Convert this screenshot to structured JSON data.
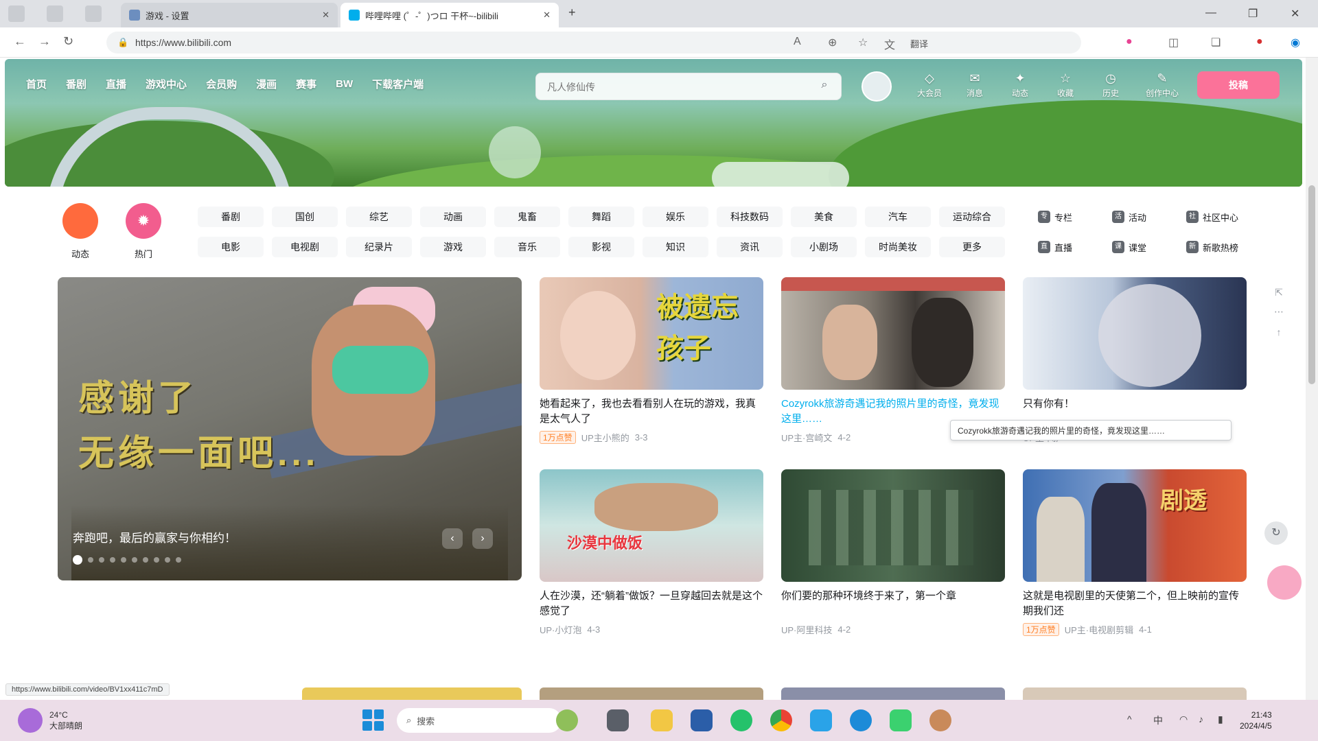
{
  "browser": {
    "tabs": [
      {
        "title": "游戏 - 设置",
        "active": false
      },
      {
        "title": "哔哩哔哩 (゜-゜)つロ 干杯~-bilibili",
        "active": true
      }
    ],
    "new_tab": "+",
    "url": "https://www.bilibili.com",
    "translate_label": "翻译"
  },
  "site": {
    "top_nav": [
      "首页",
      "番剧",
      "直播",
      "游戏中心",
      "会员购",
      "漫画",
      "赛事",
      "BW",
      "下载客户端"
    ],
    "search_placeholder": "凡人修仙传",
    "top_icons": [
      {
        "icon": "大会员",
        "label": "大会员"
      },
      {
        "icon": "消息",
        "label": "消息"
      },
      {
        "icon": "动态",
        "label": "动态"
      },
      {
        "icon": "收藏",
        "label": "收藏"
      },
      {
        "icon": "历史",
        "label": "历史"
      },
      {
        "icon": "创作中心",
        "label": "创作中心"
      }
    ],
    "upload_label": "投稿",
    "dynamic_label": "动态",
    "hot_label": "热门",
    "channels": [
      "番剧",
      "国创",
      "综艺",
      "动画",
      "鬼畜",
      "舞蹈",
      "娱乐",
      "科技数码",
      "美食",
      "汽车",
      "运动综合",
      "电影",
      "电视剧",
      "纪录片",
      "游戏",
      "音乐",
      "影视",
      "知识",
      "资讯",
      "小剧场",
      "时尚美妆",
      "更多"
    ],
    "side_links": [
      {
        "icon": "专",
        "label": "专栏"
      },
      {
        "icon": "活",
        "label": "活动"
      },
      {
        "icon": "社",
        "label": "社区中心"
      },
      {
        "icon": "直",
        "label": "直播"
      },
      {
        "icon": "课",
        "label": "课堂"
      },
      {
        "icon": "新",
        "label": "新歌热榜"
      }
    ],
    "carousel": {
      "overlay_line1": "感谢了",
      "overlay_line2": "无缘一面吧...",
      "title": "奔跑吧，最后的赢家与你相约！",
      "slides": 10
    },
    "videos": [
      {
        "title": "她看起来了，我也去看看别人在玩的游戏，我真是太气人了",
        "badge": "1万点赞",
        "author": "UP主小熊的",
        "date": "3-3",
        "overlay": "被遗忘 孩子",
        "blue": false
      },
      {
        "title": "Cozyrokk旅游奇遇记我的照片里的奇怪，竟发现这里……",
        "badge": "",
        "author": "UP主·宫崎文",
        "date": "4-2",
        "overlay": "",
        "blue": true
      },
      {
        "title": "只有你有！",
        "badge": "",
        "author": "UP主·闻声",
        "date": "4-1",
        "overlay": "",
        "blue": false
      },
      {
        "title": "人在沙漠，还“躺着”做饭？一旦穿越回去就是这个感觉了",
        "badge": "",
        "author": "UP·小灯泡",
        "date": "4-3",
        "overlay": "沙漠中做饭",
        "blue": false
      },
      {
        "title": "你们要的那种环境终于来了，第一个章",
        "badge": "",
        "author": "UP·阿里科技",
        "date": "4-2",
        "overlay": "",
        "blue": false
      },
      {
        "title": "这就是电视剧里的天使第二个，但上映前的宣传期我们还",
        "badge": "1万点赞",
        "author": "UP主·电视剧剪辑",
        "date": "4-1",
        "overlay": "剧透",
        "blue": false
      }
    ],
    "tooltip": "Cozyrokk旅游奇遇记我的照片里的奇怪，竟发现这里……"
  },
  "status_url": "https://www.bilibili.com/video/BV1xx411c7mD",
  "taskbar": {
    "weather_line1": "24°C",
    "weather_line2": "大部晴朗",
    "search_placeholder": "搜索",
    "clock_time": "21:43",
    "clock_date": "2024/4/5",
    "tray_lang": "中"
  },
  "colors": {
    "accent": "#fb7299",
    "link_blue": "#00aeec",
    "taskbar_bg": "#ecdde8"
  }
}
